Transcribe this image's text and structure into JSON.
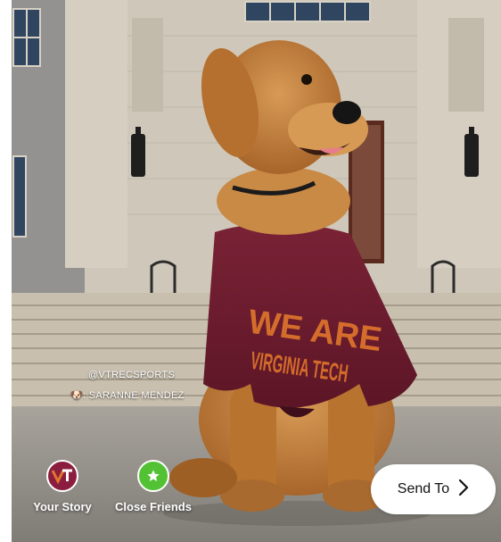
{
  "photo": {
    "credit_handle": "@VTRECSPORTS",
    "credit_name": "SARANNE MENDEZ",
    "credit_icon": "paw-icon",
    "shirt_text": [
      "WE ARE",
      "VIRGINIA TECH"
    ]
  },
  "share_targets": [
    {
      "label": "Your Story",
      "icon": "vt-logo-icon",
      "color": "#8b1e3f"
    },
    {
      "label": "Close Friends",
      "icon": "star-icon",
      "color": "#52c234"
    }
  ],
  "send_button": {
    "label": "Send To",
    "icon": "chevron-right-icon"
  },
  "colors": {
    "maroon": "#6b1e2e",
    "orange": "#e0762c",
    "close_friends_green": "#52c234",
    "button_bg": "#ffffff"
  }
}
